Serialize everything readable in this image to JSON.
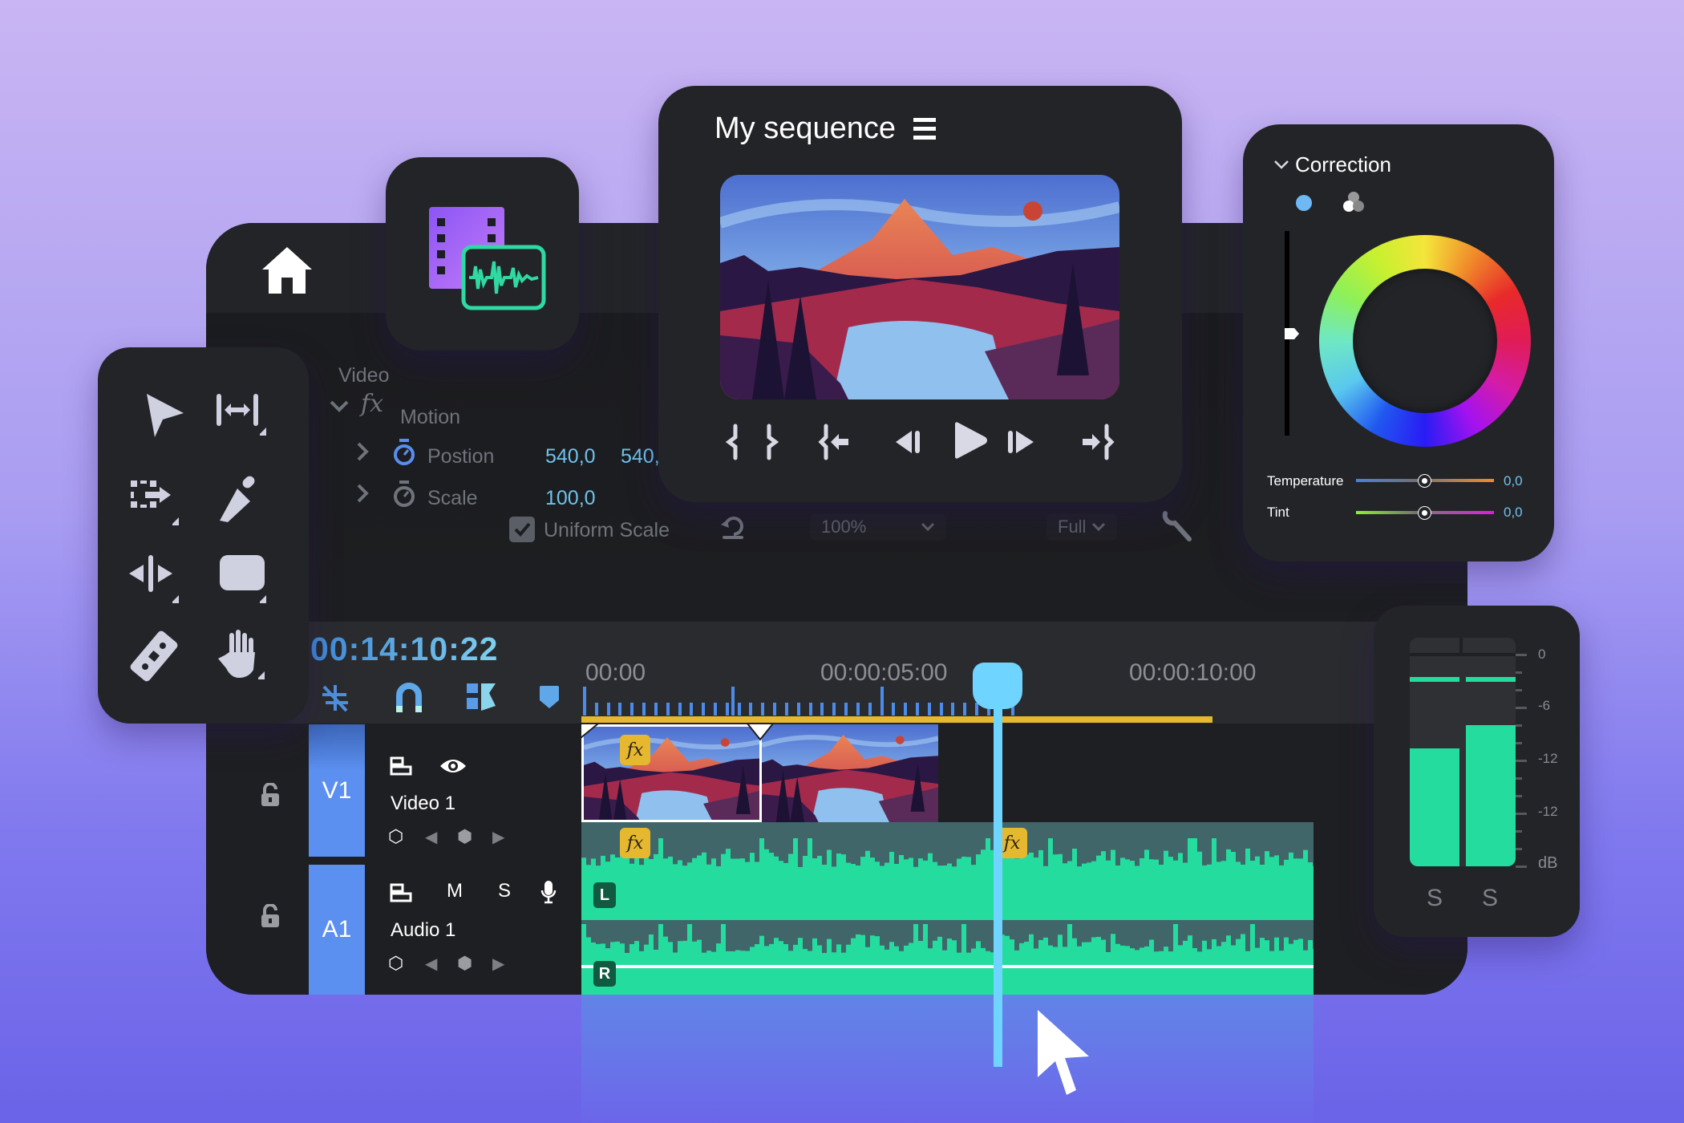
{
  "colors": {
    "accent_blue": "#5b8ff0",
    "timecode_blue": "#6ec3ec",
    "playhead": "#6fd4ff",
    "audio_green": "#24dc9e",
    "fx_yellow": "#e5b830",
    "media_purple": "#a86cf7"
  },
  "toolbar": {
    "home_icon": "home-icon",
    "media_icon": "film-audio-icon"
  },
  "effects": {
    "section": "Video",
    "effect_name": "Motion",
    "fx_glyph": "fx",
    "properties": [
      {
        "name": "Postion",
        "values": [
          "540,0",
          "540,"
        ]
      },
      {
        "name": "Scale",
        "values": [
          "100,0"
        ]
      }
    ],
    "uniform_scale_label": "Uniform Scale",
    "uniform_scale_checked": true,
    "zoom_dropdown": "100%",
    "quality_dropdown": "Full"
  },
  "sequence": {
    "title": "My sequence",
    "controls": [
      "mark-in",
      "mark-out",
      "go-to-in",
      "step-back",
      "play",
      "step-forward",
      "go-to-out"
    ]
  },
  "correction": {
    "title": "Correction",
    "sliders": [
      {
        "label": "Temperature",
        "value": "0,0",
        "position": 0.5
      },
      {
        "label": "Tint",
        "value": "0,0",
        "position": 0.5
      }
    ],
    "luma_position": 0.5
  },
  "timeline": {
    "timecode": "00:14:10:22",
    "ruler": [
      "00:00",
      "00:00:05:00",
      "00:00:10:00"
    ],
    "playhead_seconds": 6.6,
    "tracks": [
      {
        "tag": "V1",
        "name": "Video 1",
        "buttons": [
          "toggle-output",
          "eye"
        ]
      },
      {
        "tag": "A1",
        "name": "Audio 1",
        "buttons": [
          "toggle-output",
          "M",
          "S",
          "mic"
        ]
      }
    ],
    "channels": [
      "L",
      "R"
    ],
    "fx_glyph": "fx"
  },
  "meter": {
    "scale": [
      "0",
      "-6",
      "-12",
      "-12",
      "dB"
    ],
    "channels": [
      {
        "label": "S",
        "level": 0.56,
        "peak": 0.9
      },
      {
        "label": "S",
        "level": 0.67,
        "peak": 0.9
      }
    ]
  }
}
